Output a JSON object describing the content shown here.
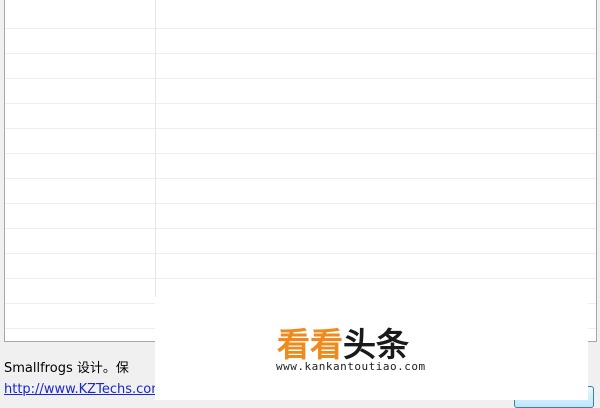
{
  "list": {
    "row_count": 13
  },
  "footer": {
    "copyright_text": "Smallfrogs 设计。保",
    "site_link": "http://www.KZTechs.com"
  },
  "watermark": {
    "logo_part1": "看看",
    "logo_part2": "头条",
    "url": "www.kankantoutiao.com"
  },
  "colors": {
    "link": "#1a27c8",
    "watermark_orange": "#f08a1c"
  }
}
